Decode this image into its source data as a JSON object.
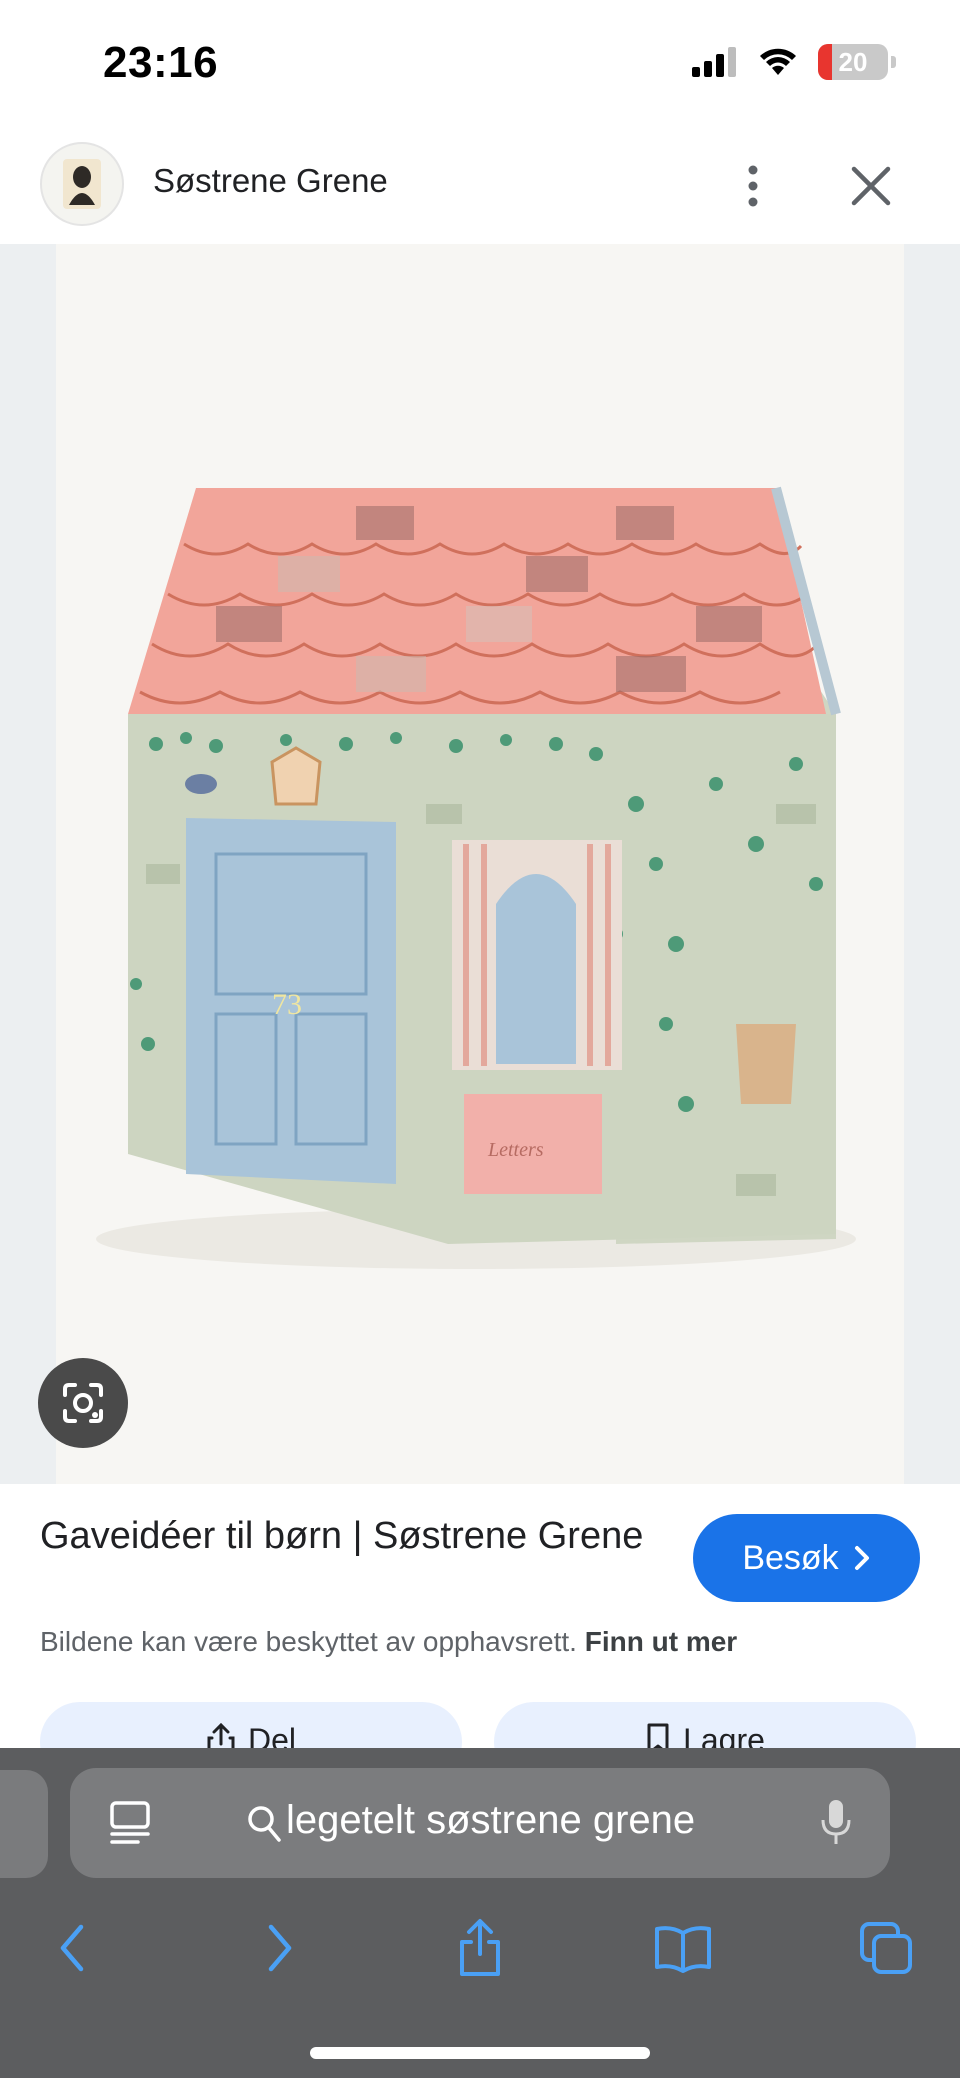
{
  "status_bar": {
    "time": "23:16",
    "battery_level": "20",
    "battery_fraction": 0.2,
    "icons": [
      "cellular-signal-icon",
      "wifi-icon",
      "battery-icon"
    ]
  },
  "header": {
    "site_name": "Søstrene Grene",
    "icons": [
      "site-logo-icon",
      "more-vert-icon",
      "close-icon"
    ]
  },
  "info": {
    "title": "Gaveidéer til børn | Søstrene Grene",
    "visit_label": "Besøk",
    "copyright_text": "Bildene kan være beskyttet av opphavsrett.",
    "learn_more": "Finn ut mer",
    "share_label": "Del",
    "save_label": "Lagre"
  },
  "safari": {
    "address_text": "legetelt søstrene grene",
    "toolbar": [
      "back-icon",
      "forward-icon",
      "share-icon",
      "bookmarks-icon",
      "tabs-icon"
    ]
  },
  "colors": {
    "accent_blue": "#1a73e8",
    "toolbar_blue": "#4aa0f5",
    "roof_pink": "#f2a59a",
    "tent_sage": "#cdd5c1",
    "door_blue": "#a9c4d9"
  }
}
